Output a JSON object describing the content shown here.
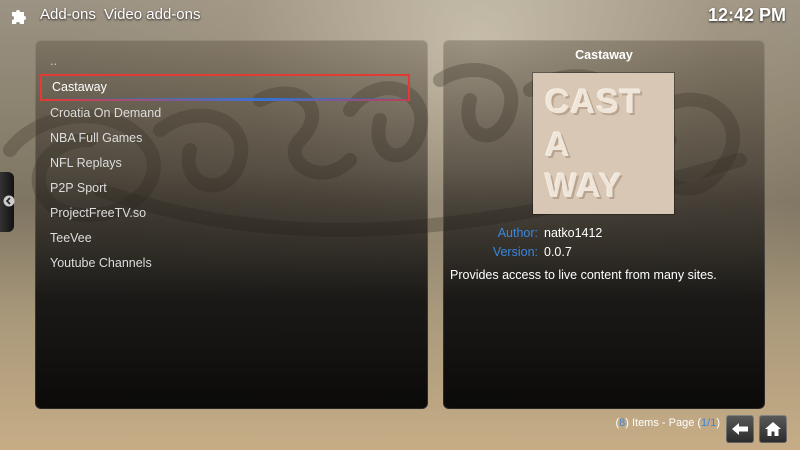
{
  "header": {
    "crumb_section": "Add-ons",
    "crumb_category": "Video add-ons",
    "clock": "12:42 PM",
    "icon": "puzzle-piece-icon"
  },
  "list": {
    "parent_label": "..",
    "items": [
      {
        "label": "Castaway",
        "selected": true
      },
      {
        "label": "Croatia On Demand"
      },
      {
        "label": "NBA Full Games"
      },
      {
        "label": "NFL Replays"
      },
      {
        "label": "P2P Sport"
      },
      {
        "label": "ProjectFreeTV.so"
      },
      {
        "label": "TeeVee"
      },
      {
        "label": "Youtube Channels"
      }
    ]
  },
  "detail": {
    "title": "Castaway",
    "thumb_lines": [
      "CAST",
      "A",
      "WAY"
    ],
    "author_label": "Author:",
    "author_value": "natko1412",
    "version_label": "Version:",
    "version_value": "0.0.7",
    "description": "Provides access to live content from many sites."
  },
  "footer": {
    "open_paren": "(",
    "count": "8",
    "items_text": ") Items - Page (",
    "page": "1/1",
    "close_paren": ")"
  },
  "colors": {
    "accent": "#3a86e0",
    "selection_border": "#e53935"
  }
}
